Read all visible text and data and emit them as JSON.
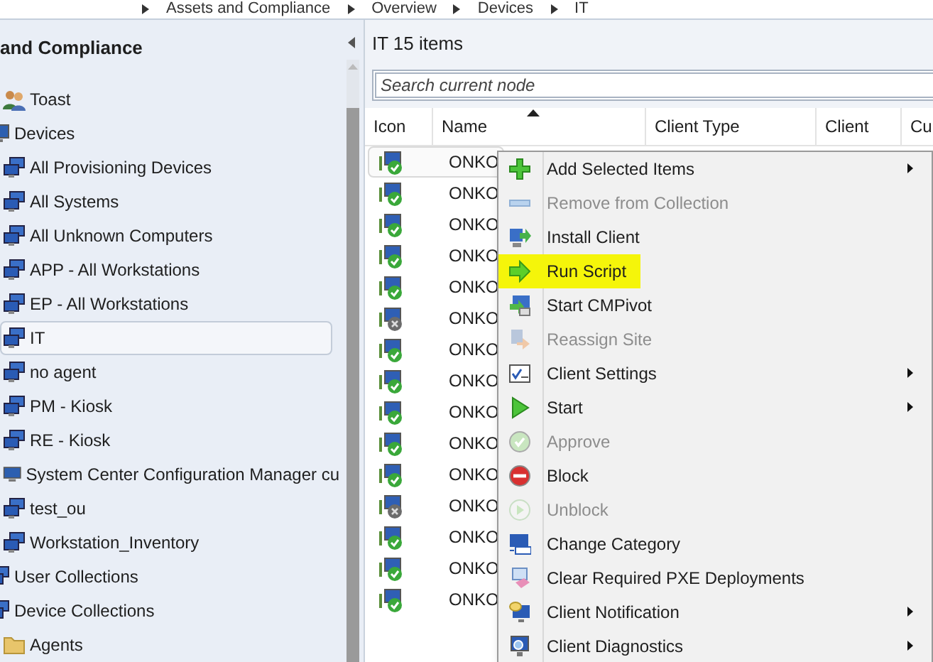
{
  "breadcrumb": [
    "Assets and Compliance",
    "Overview",
    "Devices",
    "IT"
  ],
  "navigation": {
    "title": "and Compliance",
    "tree": [
      {
        "children": [
          {
            "label": "Toast",
            "kind": "users",
            "selected": false
          }
        ]
      },
      {
        "label": "Devices",
        "kind": "computer",
        "selected": false,
        "children": [
          {
            "label": "All Provisioning Devices",
            "kind": "collection",
            "selected": false
          },
          {
            "label": "All Systems",
            "kind": "collection",
            "selected": false
          },
          {
            "label": "All Unknown Computers",
            "kind": "collection",
            "selected": false
          },
          {
            "label": "APP - All Workstations",
            "kind": "collection",
            "selected": false
          },
          {
            "label": "EP - All Workstations",
            "kind": "collection",
            "selected": false
          },
          {
            "label": "IT",
            "kind": "collection",
            "selected": true
          },
          {
            "label": "no agent",
            "kind": "collection",
            "selected": false
          },
          {
            "label": "PM - Kiosk",
            "kind": "collection",
            "selected": false
          },
          {
            "label": "RE - Kiosk",
            "kind": "collection",
            "selected": false
          },
          {
            "label": "System Center Configuration Manager cu",
            "kind": "computer",
            "selected": false
          },
          {
            "label": "test_ou",
            "kind": "collection",
            "selected": false
          },
          {
            "label": "Workstation_Inventory",
            "kind": "collection",
            "selected": false
          }
        ]
      },
      {
        "label": "User Collections",
        "kind": "collection",
        "selected": false
      },
      {
        "label": "Device Collections",
        "kind": "collection",
        "selected": false,
        "children": [
          {
            "label": "Agents",
            "kind": "folder",
            "selected": false
          }
        ]
      }
    ]
  },
  "content": {
    "title": "IT 15 items",
    "search": {
      "placeholder": "Search current node"
    },
    "table": {
      "columns": [
        "Icon",
        "Name",
        "Client Type",
        "Client",
        "Cu"
      ],
      "rows": [
        {
          "name": "ONKO",
          "ok": true,
          "selected": true
        },
        {
          "name": "ONKO",
          "ok": true,
          "selected": false
        },
        {
          "name": "ONKO",
          "ok": true,
          "selected": false
        },
        {
          "name": "ONKO",
          "ok": true,
          "selected": false
        },
        {
          "name": "ONKO",
          "ok": true,
          "selected": false
        },
        {
          "name": "ONKO",
          "ok": false,
          "selected": false
        },
        {
          "name": "ONKO",
          "ok": true,
          "selected": false
        },
        {
          "name": "ONKO",
          "ok": true,
          "selected": false
        },
        {
          "name": "ONKO",
          "ok": true,
          "selected": false
        },
        {
          "name": "ONKO",
          "ok": true,
          "selected": false
        },
        {
          "name": "ONKO",
          "ok": true,
          "selected": false
        },
        {
          "name": "ONKO",
          "ok": false,
          "selected": false
        },
        {
          "name": "ONKO",
          "ok": true,
          "selected": false
        },
        {
          "name": "ONKO",
          "ok": true,
          "selected": false
        },
        {
          "name": "ONKO",
          "ok": true,
          "selected": false
        }
      ]
    }
  },
  "context_menu": [
    {
      "label": "Add Selected Items",
      "kind": "add",
      "disabled": false,
      "submenu": true,
      "highlighted": false
    },
    {
      "label": "Remove from Collection",
      "kind": "remove",
      "disabled": true,
      "submenu": false,
      "highlighted": false
    },
    {
      "label": "Install Client",
      "kind": "install",
      "disabled": false,
      "submenu": false,
      "highlighted": false
    },
    {
      "label": "Run Script",
      "kind": "run",
      "disabled": false,
      "submenu": false,
      "highlighted": true
    },
    {
      "label": "Start CMPivot",
      "kind": "pivot",
      "disabled": false,
      "submenu": false,
      "highlighted": false
    },
    {
      "label": "Reassign Site",
      "kind": "reassign",
      "disabled": true,
      "submenu": false,
      "highlighted": false
    },
    {
      "label": "Client Settings",
      "kind": "settings",
      "disabled": false,
      "submenu": true,
      "highlighted": false
    },
    {
      "label": "Start",
      "kind": "start",
      "disabled": false,
      "submenu": true,
      "highlighted": false
    },
    {
      "label": "Approve",
      "kind": "approve",
      "disabled": true,
      "submenu": false,
      "highlighted": false
    },
    {
      "label": "Block",
      "kind": "block",
      "disabled": false,
      "submenu": false,
      "highlighted": false
    },
    {
      "label": "Unblock",
      "kind": "unblock",
      "disabled": true,
      "submenu": false,
      "highlighted": false
    },
    {
      "label": "Change Category",
      "kind": "category",
      "disabled": false,
      "submenu": false,
      "highlighted": false
    },
    {
      "label": "Clear Required PXE Deployments",
      "kind": "pxe",
      "disabled": false,
      "submenu": false,
      "highlighted": false
    },
    {
      "label": "Client Notification",
      "kind": "notify",
      "disabled": false,
      "submenu": true,
      "highlighted": false
    },
    {
      "label": "Client Diagnostics",
      "kind": "diagnose",
      "disabled": false,
      "submenu": true,
      "highlighted": false
    }
  ]
}
